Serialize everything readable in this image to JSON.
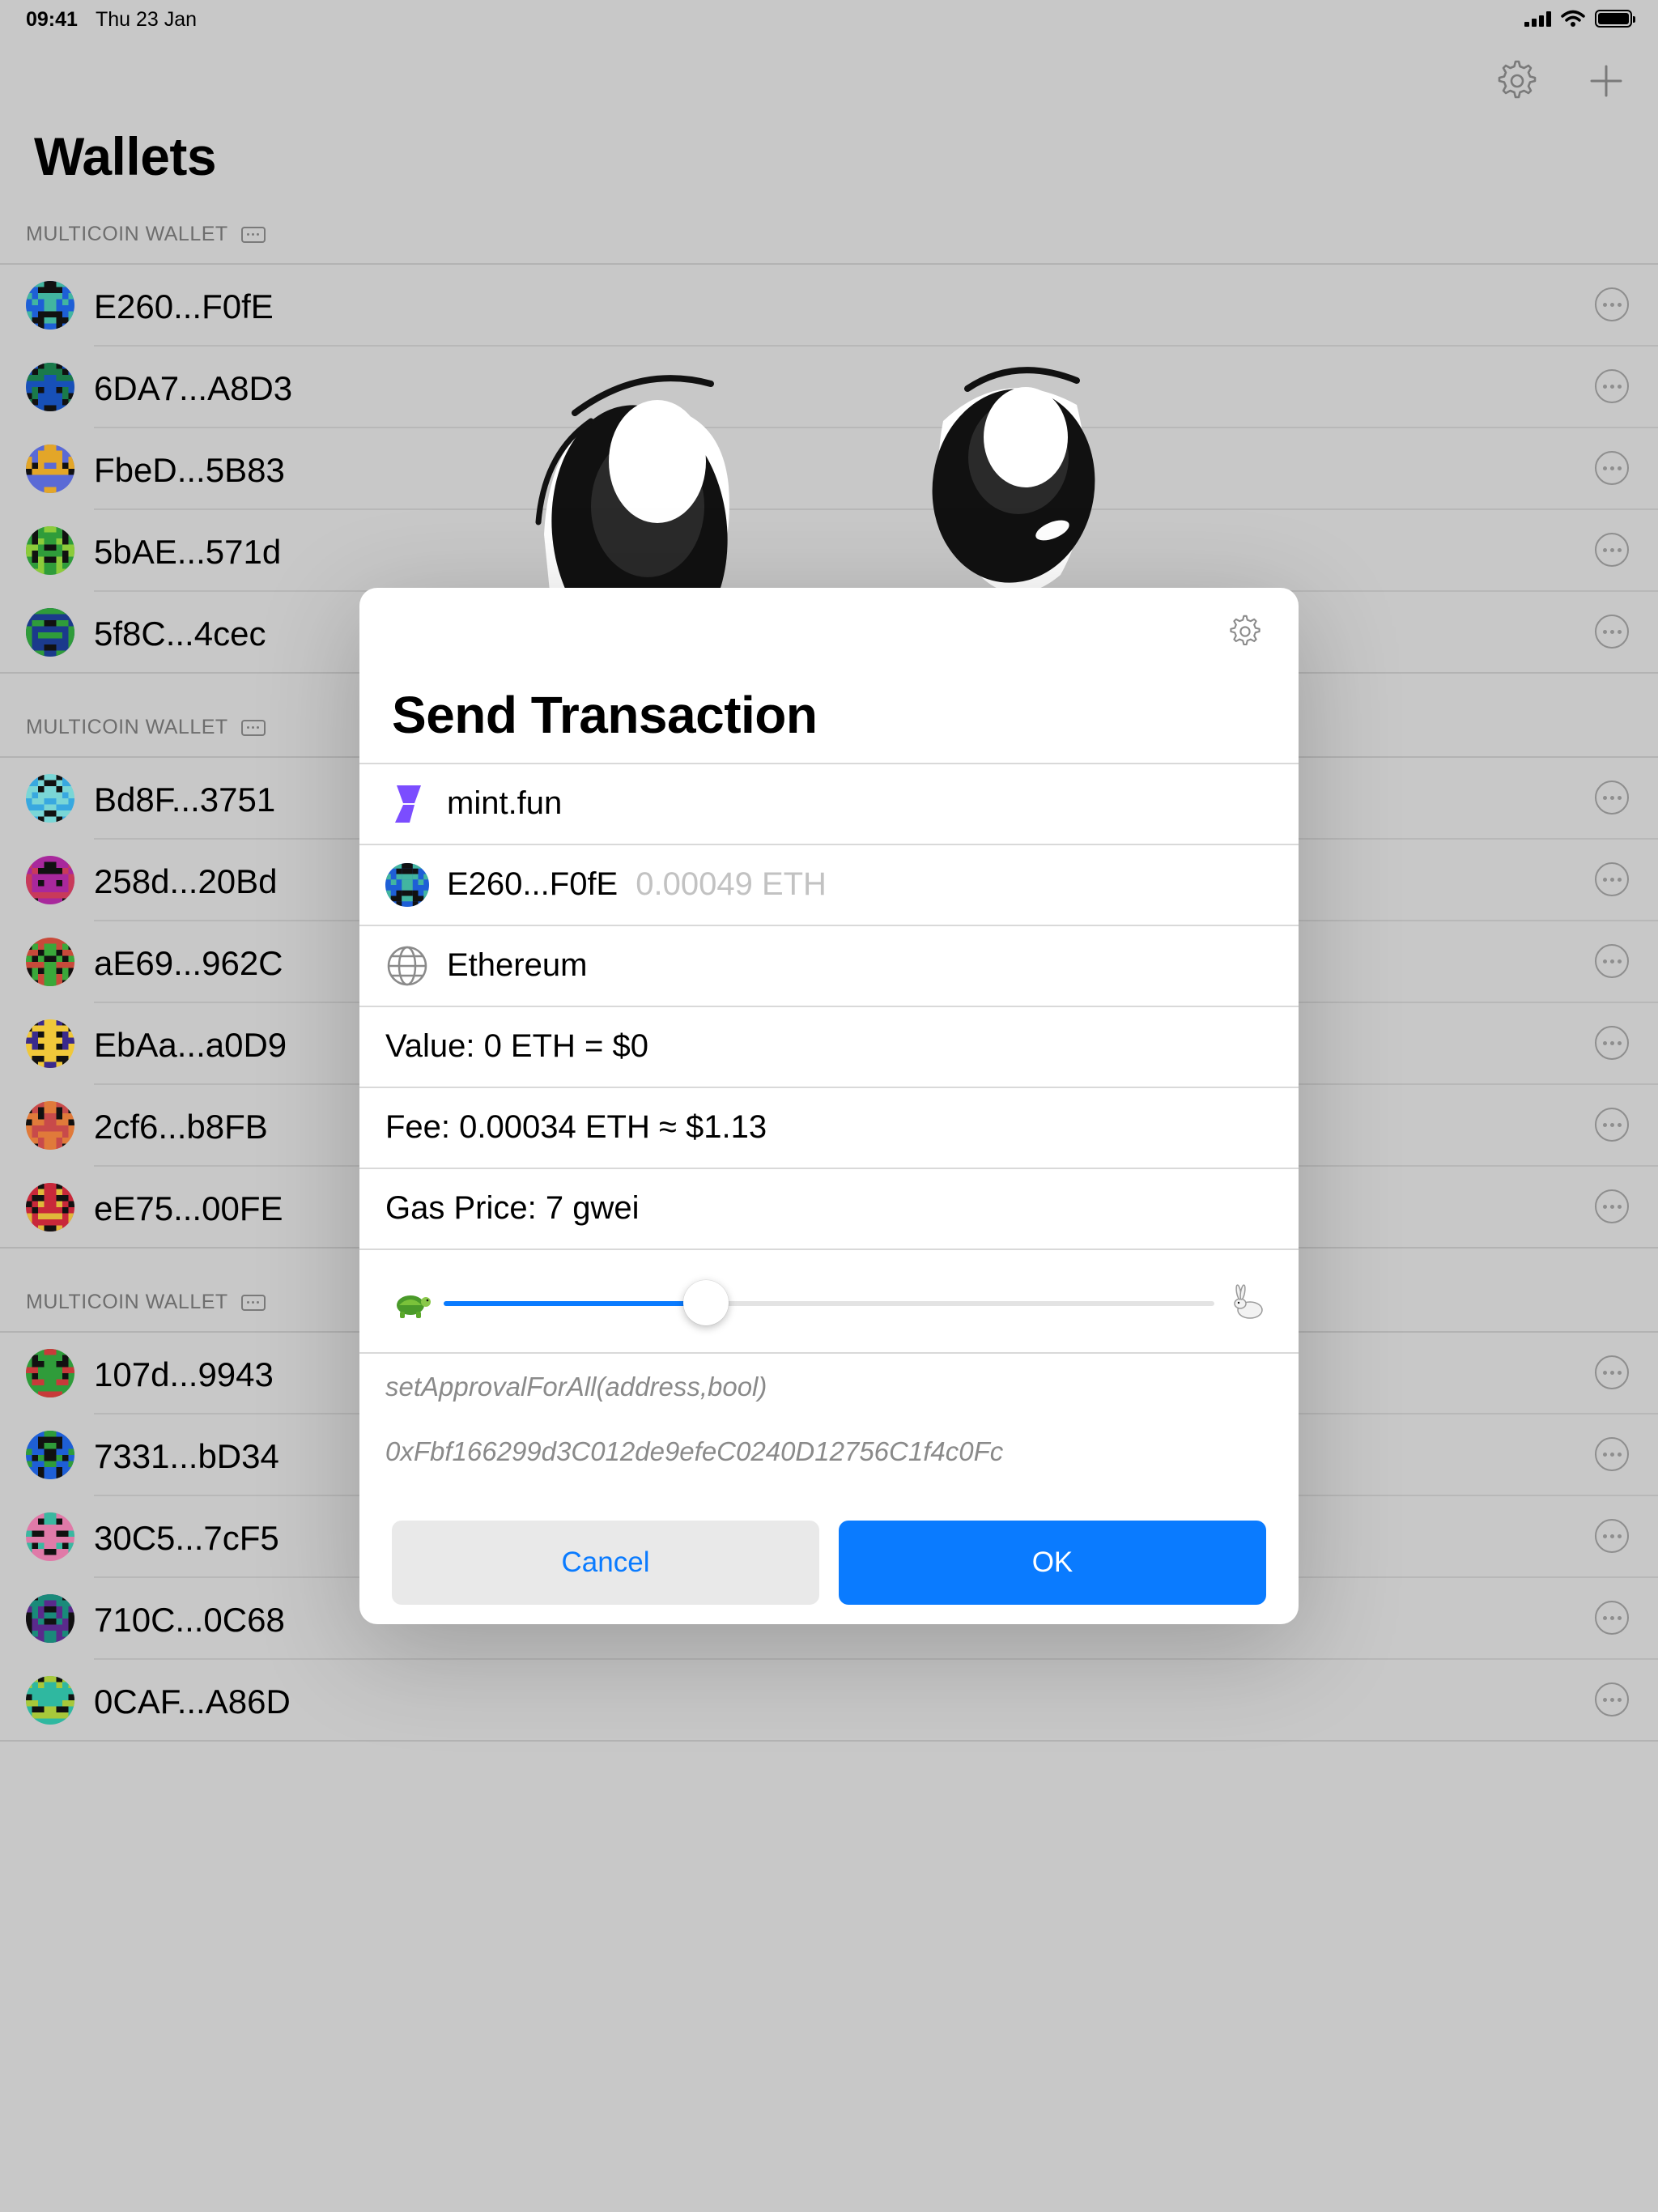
{
  "status_bar": {
    "time": "09:41",
    "date": "Thu 23 Jan"
  },
  "header": {
    "title": "Wallets"
  },
  "sections": [
    {
      "header": "MULTICOIN WALLET",
      "wallets": [
        {
          "label": "E260...F0fE",
          "colors": [
            "#1e5fd6",
            "#42b5a0"
          ]
        },
        {
          "label": "6DA7...A8D3",
          "colors": [
            "#1750b8",
            "#1a7a4a"
          ]
        },
        {
          "label": "FbeD...5B83",
          "colors": [
            "#5a6ad6",
            "#e3a628"
          ]
        },
        {
          "label": "5bAE...571d",
          "colors": [
            "#2f9c3a",
            "#8ccb3a"
          ]
        },
        {
          "label": "5f8C...4cec",
          "colors": [
            "#1b3a8c",
            "#2f9c3a"
          ]
        }
      ]
    },
    {
      "header": "MULTICOIN WALLET",
      "wallets": [
        {
          "label": "Bd8F...3751",
          "colors": [
            "#7ad6d6",
            "#38a8e0"
          ]
        },
        {
          "label": "258d...20Bd",
          "colors": [
            "#a8289c",
            "#c83a5a"
          ]
        },
        {
          "label": "aE69...962C",
          "colors": [
            "#c84a3a",
            "#3aa83a"
          ]
        },
        {
          "label": "EbAa...a0D9",
          "colors": [
            "#f0c83a",
            "#3a2a8c"
          ]
        },
        {
          "label": "2cf6...b8FB",
          "colors": [
            "#e07a3a",
            "#c84a4a"
          ]
        },
        {
          "label": "eE75...00FE",
          "colors": [
            "#c8283a",
            "#e0b83a"
          ]
        }
      ]
    },
    {
      "header": "MULTICOIN WALLET",
      "wallets": [
        {
          "label": "107d...9943",
          "colors": [
            "#2f9c3a",
            "#c83a3a"
          ]
        },
        {
          "label": "7331...bD34",
          "colors": [
            "#1e5fd6",
            "#2f9c3a"
          ]
        },
        {
          "label": "30C5...7cF5",
          "colors": [
            "#e07aa8",
            "#3ab8a0"
          ]
        },
        {
          "label": "710C...0C68",
          "colors": [
            "#5a2a8c",
            "#1a8a7a"
          ]
        },
        {
          "label": "0CAF...A86D",
          "colors": [
            "#2fb8a0",
            "#a8c83a"
          ]
        }
      ]
    }
  ],
  "modal": {
    "title": "Send Transaction",
    "dapp": "mint.fun",
    "account": "E260...F0fE",
    "balance": "0.00049 ETH",
    "network": "Ethereum",
    "value": "Value: 0 ETH = $0",
    "fee": "Fee: 0.00034 ETH ≈ $1.13",
    "gas_price": "Gas Price: 7 gwei",
    "gas_slider_fraction": 0.34,
    "function": "setApprovalForAll(address,bool)",
    "address": "0xFbf166299d3C012de9efeC0240D12756C1f4c0Fc",
    "cancel_label": "Cancel",
    "ok_label": "OK"
  },
  "colors": {
    "accent": "#0a7bff",
    "dapp_brand": "#7b4dff"
  }
}
